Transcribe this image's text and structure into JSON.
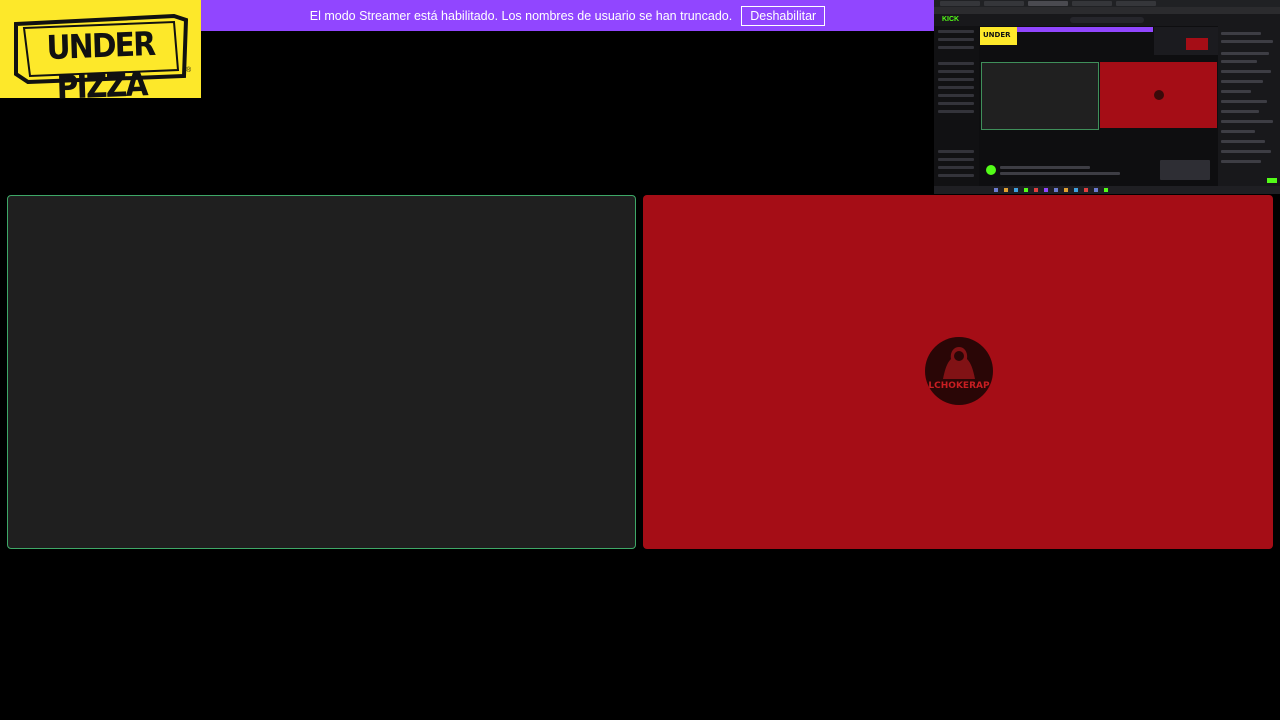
{
  "logo": {
    "text": "UNDER PIZZA",
    "registered_mark": "®"
  },
  "streamer_banner": {
    "message": "El modo Streamer está habilitado. Los nombres de usuario se han truncado.",
    "disable_button": "Deshabilitar"
  },
  "preview": {
    "site_logo": "KICK",
    "mini_logo": "UNDER"
  },
  "right_panel": {
    "avatar_label": "LCHOKERAP"
  },
  "colors": {
    "banner": "#9146ff",
    "logo_bg": "#fde82a",
    "left_panel": "#1f1f1f",
    "left_border": "#3ea867",
    "right_panel": "#a50d16"
  },
  "icons": {
    "logo": "underpizza-logo-icon",
    "avatar": "channel-avatar-icon"
  }
}
